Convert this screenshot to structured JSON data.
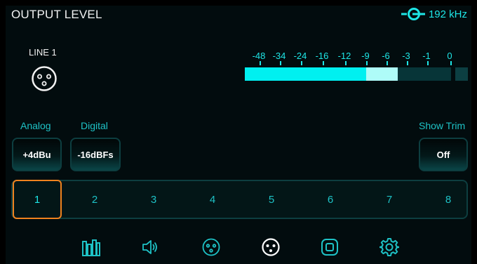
{
  "header": {
    "title": "OUTPUT LEVEL",
    "sample_rate": "192 kHz"
  },
  "channel_display": {
    "label": "LINE 1",
    "icon": "xlr-connector-icon"
  },
  "meter": {
    "scale": [
      "-48",
      "-34",
      "-24",
      "-16",
      "-12",
      "-9",
      "-6",
      "-3",
      "-1",
      "0"
    ],
    "level_fraction": 0.59,
    "peak_fraction": 0.74,
    "colors": {
      "level": "#00f0f0",
      "peak": "#aefcf8",
      "empty": "#073538",
      "clip_box": "#0c3f42"
    }
  },
  "controls": {
    "analog": {
      "label": "Analog",
      "value": "+4dBu"
    },
    "digital": {
      "label": "Digital",
      "value": "-16dBFs"
    },
    "show_trim": {
      "label": "Show Trim",
      "value": "Off"
    }
  },
  "channels": {
    "items": [
      "1",
      "2",
      "3",
      "4",
      "5",
      "6",
      "7",
      "8"
    ],
    "selected": "1"
  },
  "bottom_nav": {
    "items": [
      "meters-icon",
      "speaker-icon",
      "xlr-input-icon",
      "xlr-output-icon",
      "square-button-icon",
      "settings-gear-icon"
    ],
    "active": "xlr-output-icon"
  },
  "colors": {
    "accent": "#1ee6e6",
    "selection": "#f0821e",
    "background": "#020c0e"
  }
}
